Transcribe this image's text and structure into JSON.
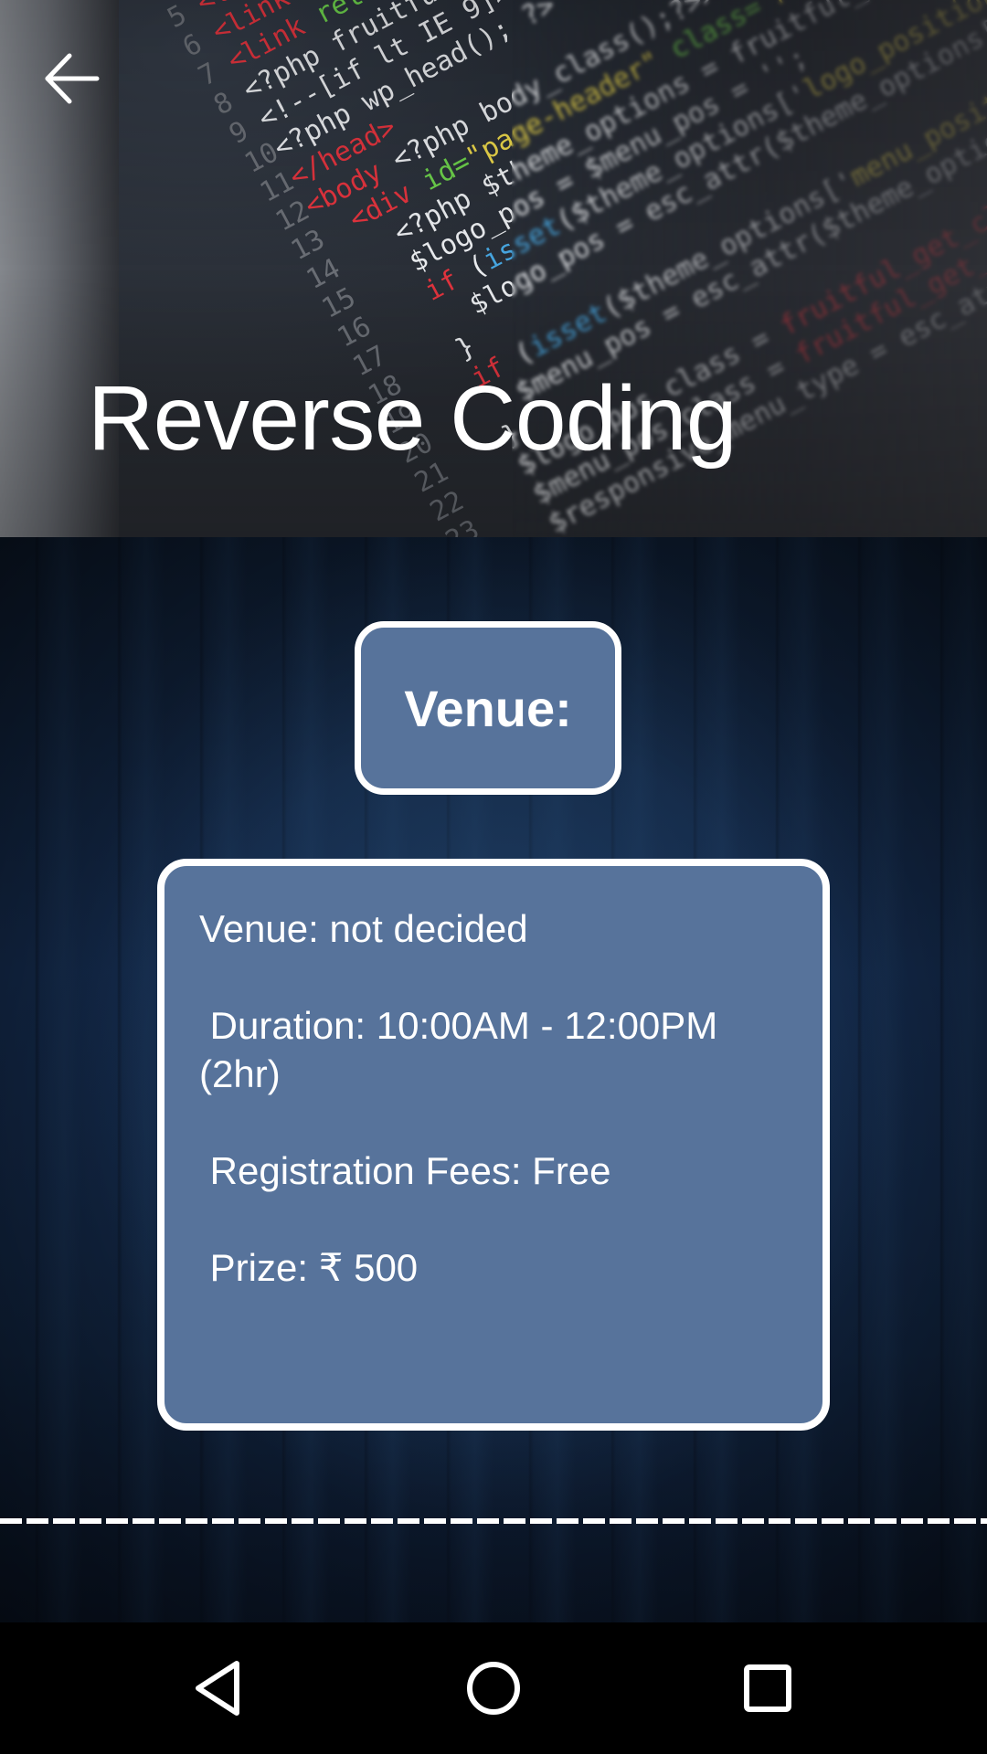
{
  "header": {
    "title": "Reverse Coding",
    "back_icon": "arrow-left-icon"
  },
  "venue_heading": {
    "label": "Venue:"
  },
  "details": {
    "venue": "Venue: not decided",
    "duration": " Duration: 10:00AM - 12:00PM (2hr)",
    "fees": " Registration Fees: Free",
    "prize": " Prize: ₹ 500"
  },
  "colors": {
    "card_background": "#57739b",
    "card_border": "#ffffff",
    "page_background": "#10223c",
    "navbar_background": "#000000"
  },
  "navbar": {
    "icons": [
      "nav-back-icon",
      "nav-home-icon",
      "nav-recents-icon"
    ]
  }
}
